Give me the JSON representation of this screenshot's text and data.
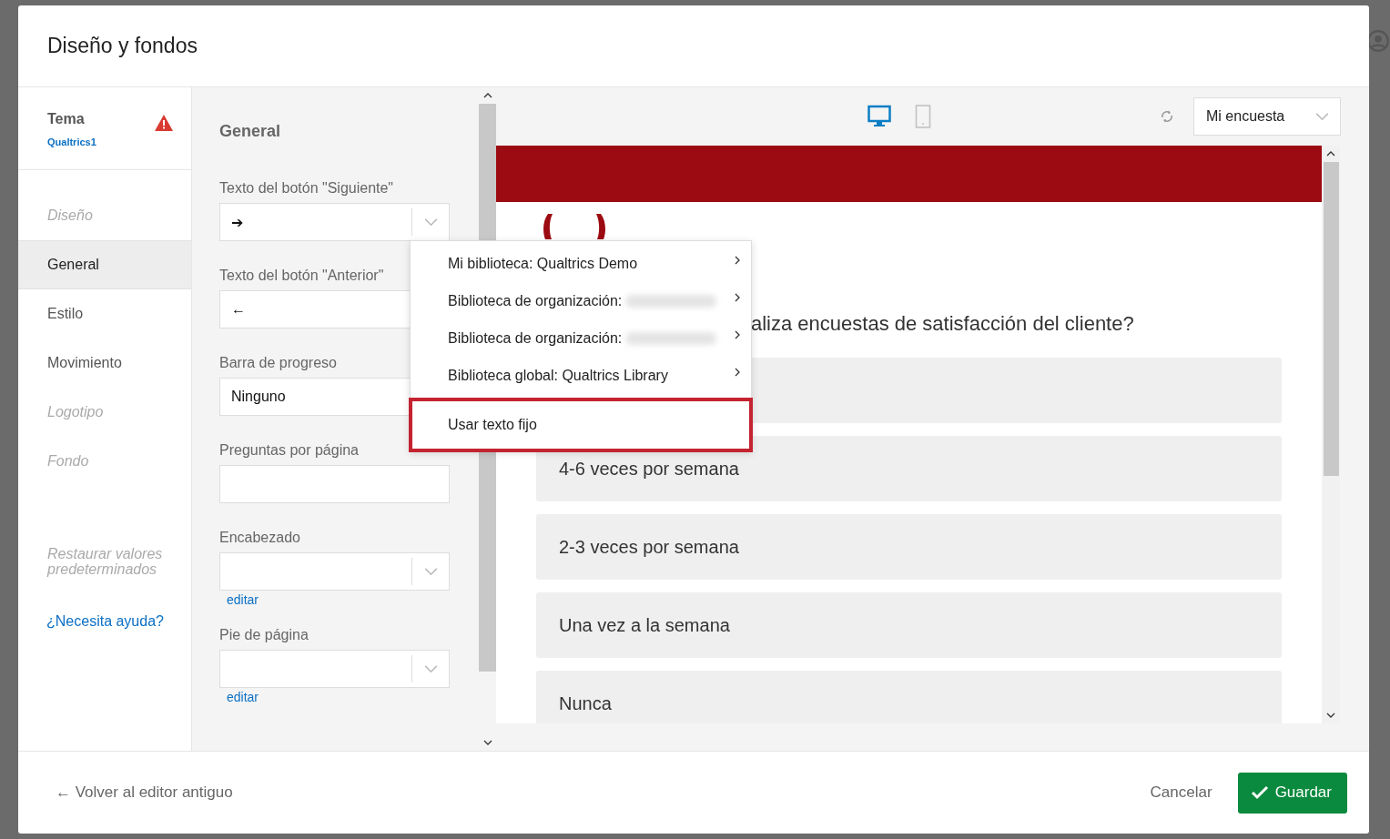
{
  "window": {
    "title": "Diseño y fondos"
  },
  "sidebar": {
    "theme_label": "Tema",
    "theme_name": "Qualtrics1",
    "theme_warning": true,
    "items": [
      {
        "label": "Diseño",
        "disabled": true,
        "selected": false
      },
      {
        "label": "General",
        "disabled": false,
        "selected": true
      },
      {
        "label": "Estilo",
        "disabled": false,
        "selected": false
      },
      {
        "label": "Movimiento",
        "disabled": false,
        "selected": false
      },
      {
        "label": "Logotipo",
        "disabled": true,
        "selected": false
      },
      {
        "label": "Fondo",
        "disabled": true,
        "selected": false
      }
    ],
    "restore": "Restaurar valores predeterminados",
    "help": "¿Necesita ayuda?"
  },
  "settings": {
    "heading": "General",
    "fields": [
      {
        "label": "Texto del botón \"Siguiente\"",
        "kind": "select",
        "value": "➔"
      },
      {
        "label": "Texto del botón \"Anterior\"",
        "kind": "select",
        "value": "←"
      },
      {
        "label": "Barra de progreso",
        "kind": "select",
        "value": "Ninguno"
      },
      {
        "label": "Preguntas por página",
        "kind": "input"
      },
      {
        "label": "Encabezado",
        "kind": "select",
        "link": "editar"
      },
      {
        "label": "Pie de página",
        "kind": "select",
        "link": "editar"
      }
    ]
  },
  "menu": {
    "items": [
      {
        "label": "Mi biblioteca: Qualtrics Demo",
        "submenu": true,
        "blurred": false,
        "highlighted": false
      },
      {
        "label": "Biblioteca de organización:",
        "submenu": true,
        "blurred": true,
        "highlighted": false
      },
      {
        "label": "Biblioteca de organización:",
        "submenu": true,
        "blurred": true,
        "highlighted": false
      },
      {
        "label": "Biblioteca global: Qualtrics Library",
        "submenu": true,
        "blurred": false,
        "highlighted": false
      },
      {
        "label": "Usar texto fijo",
        "submenu": false,
        "blurred": false,
        "highlighted": true
      }
    ]
  },
  "preview": {
    "devices": [
      {
        "kind": "desktop",
        "selected": true
      },
      {
        "kind": "mobile",
        "selected": false
      }
    ],
    "survey_select": "Mi encuesta",
    "question": "aliza encuestas de satisfacción del cliente?",
    "choices": [
      "4-6 veces por semana",
      "2-3 veces por semana",
      "Una vez a la semana",
      "Nunca"
    ]
  },
  "footer": {
    "back": "← Volver al editor antiguo",
    "cancel": "Cancelar",
    "save": "Guardar"
  }
}
